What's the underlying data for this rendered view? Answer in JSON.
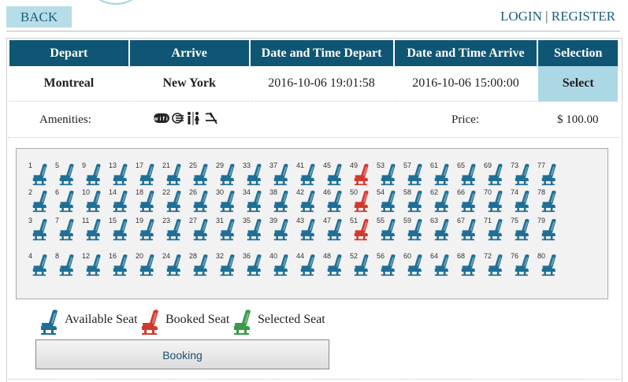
{
  "header": {
    "back_label": "BACK",
    "login_label": "LOGIN",
    "separator": "|",
    "register_label": "REGISTER"
  },
  "table": {
    "headers": [
      "Depart",
      "Arrive",
      "Date and Time Depart",
      "Date and Time Arrive",
      "Selection"
    ],
    "row": {
      "depart": "Montreal",
      "arrive": "New York",
      "date_depart": "2016-10-06 19:01:58",
      "date_arrive": "2016-10-06 15:00:00",
      "select_label": "Select"
    }
  },
  "amenities": {
    "label": "Amenities:",
    "icons": [
      "wifi-icon",
      "air-conditioning-icon",
      "restroom-icon",
      "no-smoking-icon"
    ],
    "icon_glyphs": "wifi ☰ 🚻 ✈",
    "price_label": "Price:",
    "price_value": "$ 100.00"
  },
  "seats": {
    "count": 80,
    "booked": [
      49,
      50,
      51
    ],
    "colors": {
      "available": "#1f6f96",
      "booked": "#d23a2e",
      "selected": "#3a9a48"
    }
  },
  "legend": {
    "available_label": "Available Seat",
    "booked_label": "Booked Seat",
    "selected_label": "Selected Seat"
  },
  "booking_label": "Booking"
}
